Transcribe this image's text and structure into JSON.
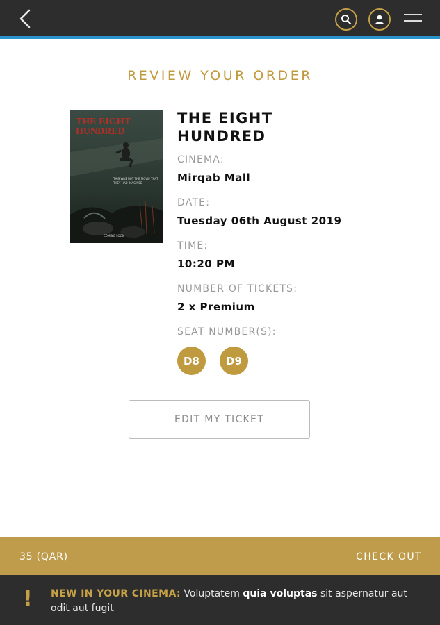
{
  "header": {
    "back_icon": "chevron-left-icon",
    "search_icon": "search-icon",
    "account_icon": "user-icon",
    "menu_icon": "hamburger-menu-icon",
    "accent_color": "#2a93c9"
  },
  "page_title": "REVIEW YOUR ORDER",
  "movie": {
    "poster_title": "THE EIGHT HUNDRED",
    "poster_tagline": "THIS WAS NOT THE MOVIE THAT THEY HAD IMAGINED",
    "poster_footer": "COMING SOON",
    "title": "THE EIGHT HUNDRED"
  },
  "details": {
    "cinema_label": "CINEMA:",
    "cinema_value": "Mirqab Mall",
    "date_label": "DATE:",
    "date_value": "Tuesday 06th August 2019",
    "time_label": "TIME:",
    "time_value": "10:20 PM",
    "tickets_label": "NUMBER OF TICKETS:",
    "tickets_value": "2 x Premium",
    "seats_label": "SEAT NUMBER(S):",
    "seats": [
      "D8",
      "D9"
    ]
  },
  "edit_button": "EDIT MY TICKET",
  "checkout": {
    "price": "35 (QAR)",
    "button": "CHECK OUT",
    "color": "#bf9c4c"
  },
  "news": {
    "icon": "exclamation-icon",
    "label": "NEW IN YOUR CINEMA:",
    "text_1": " Voluptatem ",
    "text_bold": "quia voluptas",
    "text_2": " sit aspernatur aut odit aut fugit"
  }
}
